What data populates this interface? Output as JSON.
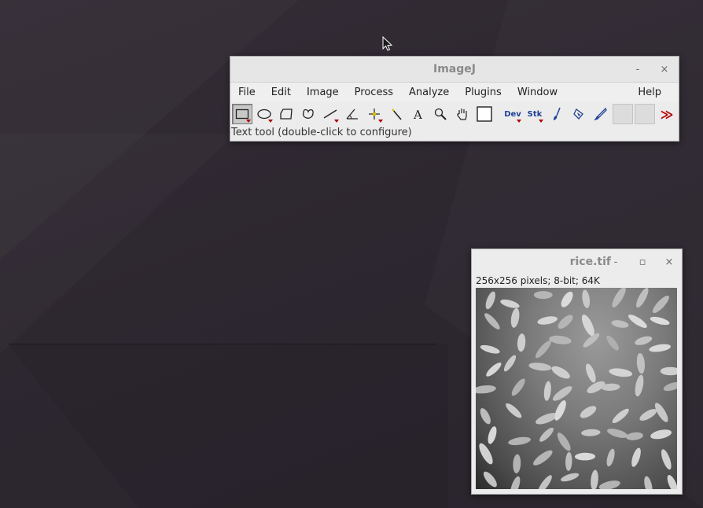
{
  "imagej": {
    "title": "ImageJ",
    "controls": {
      "minimize": "-",
      "close": "×"
    },
    "menus": [
      "File",
      "Edit",
      "Image",
      "Process",
      "Analyze",
      "Plugins",
      "Window"
    ],
    "help": "Help",
    "tools": {
      "dev": "Dev",
      "stk": "Stk",
      "more": "≫"
    },
    "status": "Text tool (double-click to configure)"
  },
  "rice": {
    "title": "rice.tif",
    "controls": {
      "minimize": "-",
      "maximize": "▫",
      "close": "×"
    },
    "info": "256x256 pixels; 8-bit; 64K"
  },
  "icons": {
    "tools": [
      "rectangle-icon",
      "oval-icon",
      "polygon-icon",
      "freehand-icon",
      "line-icon",
      "angle-icon",
      "point-icon",
      "wand-icon",
      "text-icon",
      "magnifier-icon",
      "hand-icon",
      "color-picker-icon",
      "dev-icon",
      "stk-icon",
      "brush-icon",
      "flood-fill-icon",
      "pencil-icon",
      "blank-tool",
      "blank-tool",
      "more-tools-icon"
    ]
  }
}
